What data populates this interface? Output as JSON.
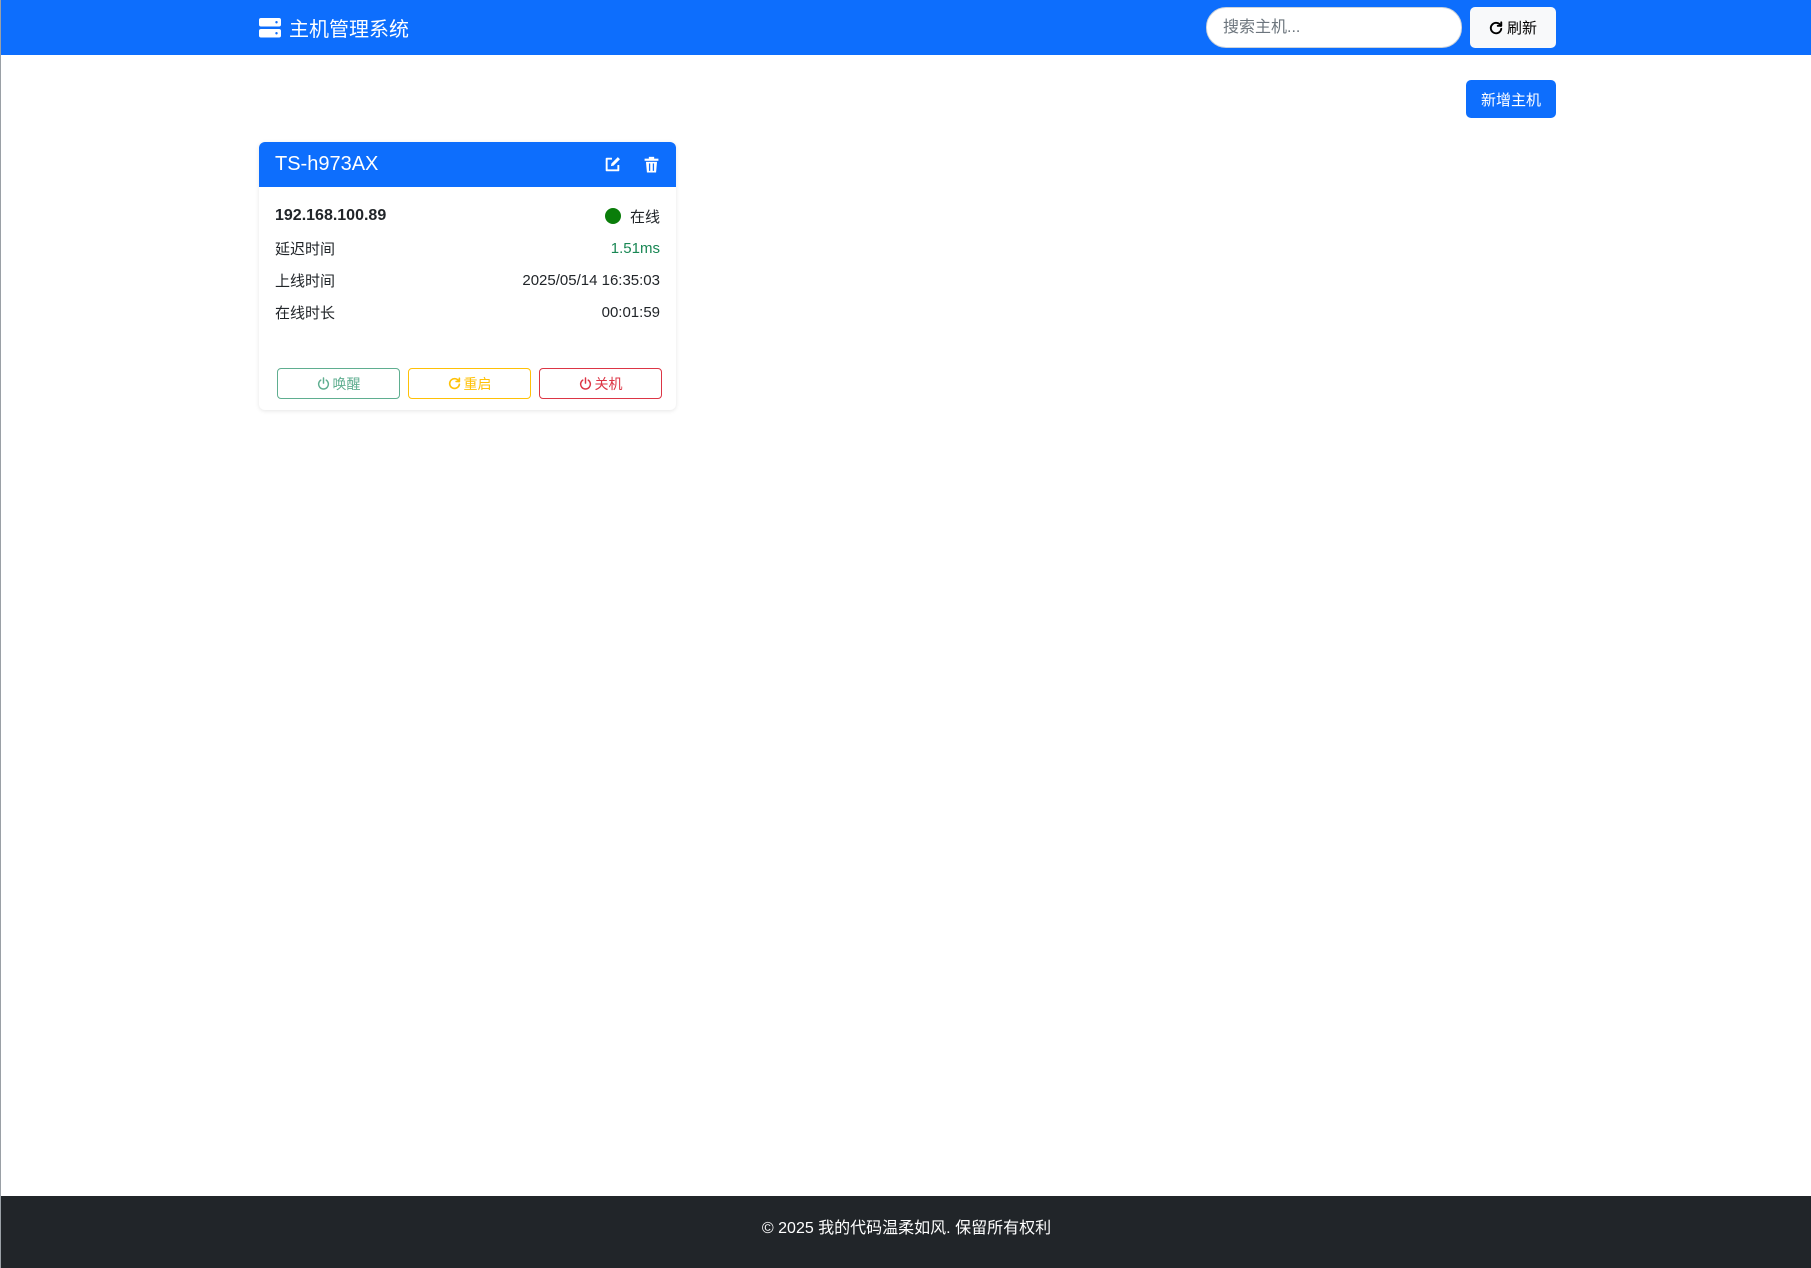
{
  "navbar": {
    "brand_icon": "server-icon",
    "brand_title": "主机管理系统",
    "search_placeholder": "搜索主机...",
    "search_value": "",
    "refresh_icon": "refresh-icon",
    "refresh_label": "刷新"
  },
  "toolbar": {
    "add_host_label": "新增主机"
  },
  "host_card": {
    "name": "TS-h973AX",
    "edit_icon": "edit-icon",
    "delete_icon": "trash-icon",
    "ip": "192.168.100.89",
    "status_text": "在线",
    "status_color": "#0a7d0a",
    "latency_label": "延迟时间",
    "latency_value": "1.51ms",
    "latency_color": "#198754",
    "online_since_label": "上线时间",
    "online_since_value": "2025/05/14 16:35:03",
    "uptime_label": "在线时长",
    "uptime_value": "00:01:59",
    "actions": {
      "wake_label": "唤醒",
      "restart_label": "重启",
      "shutdown_label": "关机"
    }
  },
  "footer": {
    "text": "© 2025 我的代码温柔如风. 保留所有权利"
  },
  "colors": {
    "primary": "#0d6efd",
    "footer_bg": "#212529",
    "wake": "#5fae90",
    "restart": "#ffc107",
    "shutdown": "#dc3545"
  }
}
